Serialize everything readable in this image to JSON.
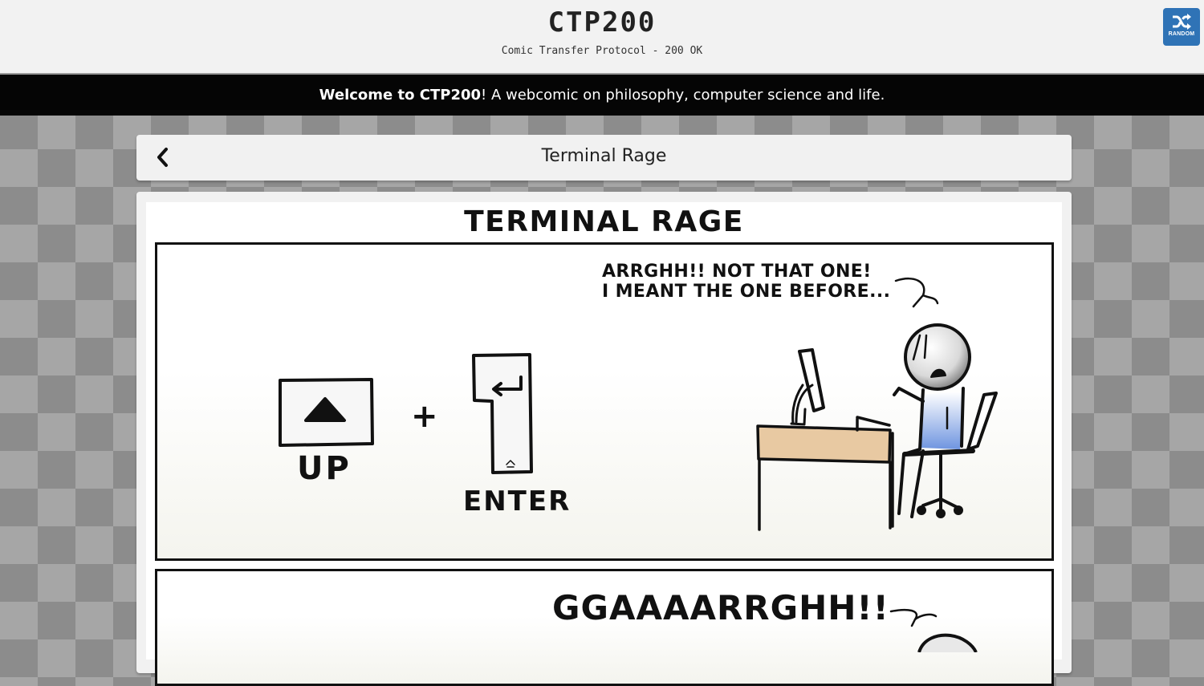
{
  "header": {
    "title": "CTP200",
    "subtitle": "Comic Transfer Protocol - 200 OK",
    "random_button": {
      "label": "RANDOM",
      "icon": "shuffle-icon"
    }
  },
  "welcome": {
    "brand": "Welcome to CTP200",
    "message": "! A webcomic on philosophy, computer science and life."
  },
  "comic": {
    "title": "Terminal Rage",
    "back_icon": "chevron-left-icon",
    "image_heading": "TERMINAL RAGE",
    "panel_1": {
      "speech_line_1": "ARRGHH!! NOT THAT ONE!",
      "speech_line_2": "I MEANT THE ONE BEFORE...",
      "key_up_label": "UP",
      "plus": "+",
      "key_enter_label": "ENTER"
    },
    "panel_2": {
      "speech": "GGAAAARRGHH!!"
    }
  },
  "colors": {
    "header_bg": "#f2f2f2",
    "welcome_bar_bg": "#050505",
    "random_button_bg": "#2f73b6",
    "checker_light": "#a6a6a6",
    "checker_dark": "#8c8c8c",
    "desk_top": "#e8c9a2",
    "shirt_blue": "#6f95e0"
  }
}
